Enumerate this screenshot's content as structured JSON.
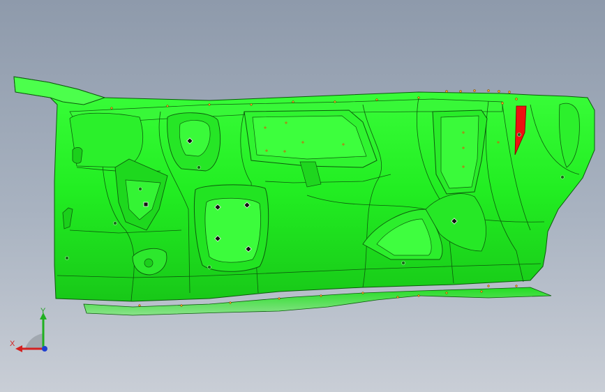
{
  "viewport": {
    "background_top": "#8e9aab",
    "background_bottom": "#c9ced6"
  },
  "model": {
    "name": "floor-panel-part",
    "fill_color": "#22ee22",
    "edge_color": "#0c5a0c",
    "highlight_color": "#ee1111"
  },
  "triad": {
    "x_label": "X",
    "y_label": "Y",
    "x_color": "#d42020",
    "y_color": "#20b020",
    "z_color": "#2040d0"
  }
}
